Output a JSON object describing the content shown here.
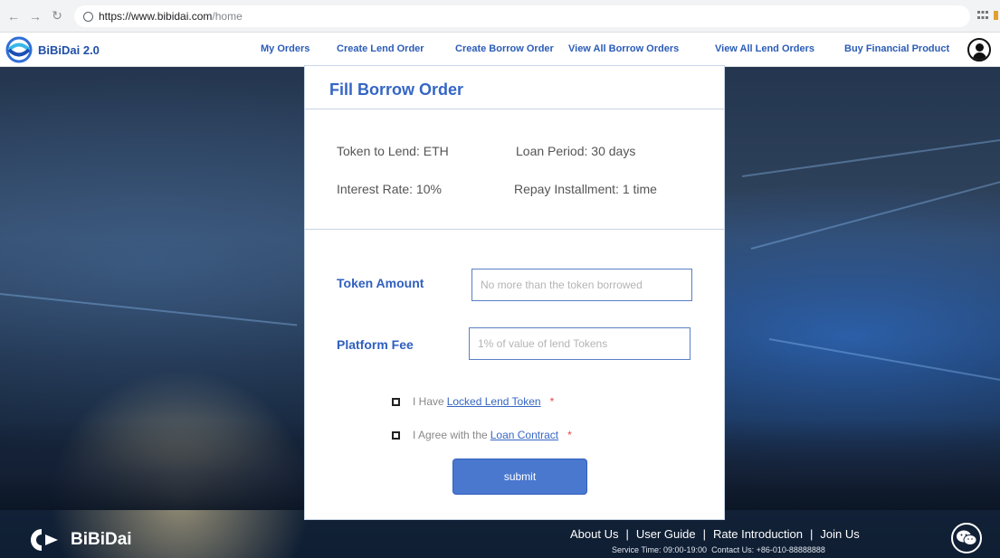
{
  "browser": {
    "url_host": "https://www.bibidai.com",
    "url_path": "/home"
  },
  "header": {
    "logo_text": "BiBiDai 2.0",
    "nav": [
      "My Orders",
      "Create Lend Order",
      "Create Borrow  Order",
      "View All  Borrow Orders",
      "View All Lend Orders",
      "Buy Financial Product"
    ]
  },
  "modal": {
    "title": "Fill Borrow Order",
    "token_to_lend": "Token to Lend: ETH",
    "loan_period": "Loan Period:  30  days",
    "interest_rate": "Interest Rate:  10%",
    "repay_installment": "Repay Installment:  1 time",
    "token_amount_label": "Token Amount",
    "token_amount_placeholder": "No more than the token borrowed",
    "platform_fee_label": "Platform Fee",
    "platform_fee_placeholder": "1% of value of lend Tokens",
    "check1_text": "I Have",
    "check1_link": "Locked Lend Token",
    "check2_text": "I Agree with the",
    "check2_link": "Loan Contract",
    "asterisk": "*",
    "submit_label": "submit"
  },
  "footer": {
    "logo_text": "BiBiDai",
    "links": [
      "About Us",
      "User Guide",
      "Rate Introduction",
      "Join Us"
    ],
    "separator": "|",
    "service_time": "Service Time: 09:00-19:00",
    "contact": "Contact Us: +86-010-88888888"
  },
  "colors": {
    "accent": "#3566c4",
    "button": "#4a78cf",
    "required": "#e44545"
  },
  "icons": [
    "back-arrow-icon",
    "forward-arrow-icon",
    "reload-icon",
    "secure-globe-icon",
    "user-avatar-icon",
    "wechat-icon"
  ]
}
